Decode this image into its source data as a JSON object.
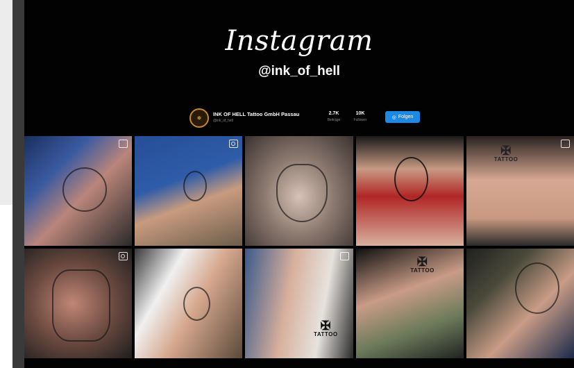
{
  "header": {
    "title": "Instagram",
    "handle": "@ink_of_hell"
  },
  "profile": {
    "name": "INK OF HELL Tattoo GmbH Passau",
    "username": "@ink_of_hell",
    "stats": [
      {
        "value": "2.7K",
        "label": "Beiträge"
      },
      {
        "value": "10K",
        "label": "Follower"
      }
    ],
    "follow_label": "Folgen"
  },
  "watermark": {
    "text": "TATTOO"
  },
  "colors": {
    "background": "#020202",
    "follow_button": "#1e88e5"
  },
  "posts": [
    {
      "type": "multi-photo-icon"
    },
    {
      "type": "video-icon"
    },
    {
      "type": "photo"
    },
    {
      "type": "photo"
    },
    {
      "type": "multi-photo-icon"
    },
    {
      "type": "video-icon"
    },
    {
      "type": "photo"
    },
    {
      "type": "multi-photo-icon"
    },
    {
      "type": "photo"
    },
    {
      "type": "photo"
    }
  ]
}
